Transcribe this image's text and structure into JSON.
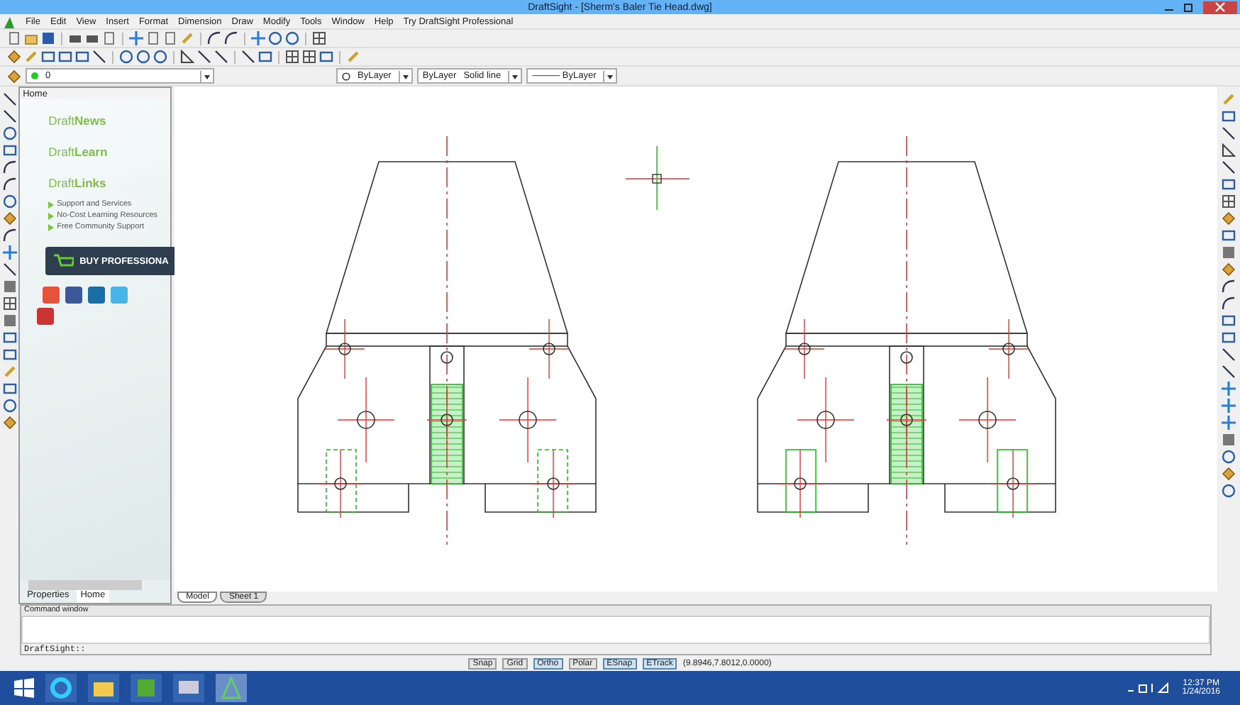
{
  "window": {
    "title": "DraftSight - [Sherm's Baler Tie Head.dwg]"
  },
  "menu": [
    "File",
    "Edit",
    "View",
    "Insert",
    "Format",
    "Dimension",
    "Draw",
    "Modify",
    "Tools",
    "Window",
    "Help",
    "Try DraftSight Professional"
  ],
  "layer_bar": {
    "layer": "0",
    "color_setting": "ByLayer",
    "linetype_layer": "ByLayer",
    "linetype": "Solid line",
    "lineweight": "——— ByLayer"
  },
  "palette": {
    "title": "Home",
    "sections": [
      "Draft**News**",
      "Draft**Learn**",
      "Draft**Links**"
    ],
    "links": [
      "Support and Services",
      "No-Cost Learning Resources",
      "Free Community Support"
    ],
    "buy_button": "BUY PROFESSIONA",
    "tabs": [
      {
        "label": "Properties",
        "selected": false
      },
      {
        "label": "Home",
        "selected": true
      }
    ]
  },
  "sheet_tabs": [
    {
      "label": "Model",
      "selected": true
    },
    {
      "label": "Sheet 1",
      "selected": false
    }
  ],
  "command_window": {
    "title": "Command window",
    "prompt": "DraftSight::"
  },
  "status_bar": {
    "toggles": [
      {
        "label": "Snap",
        "on": false
      },
      {
        "label": "Grid",
        "on": false
      },
      {
        "label": "Ortho",
        "on": true
      },
      {
        "label": "Polar",
        "on": false
      },
      {
        "label": "ESnap",
        "on": true
      },
      {
        "label": "ETrack",
        "on": true
      }
    ],
    "coordinates": "(9.8946,7.8012,0.0000)"
  },
  "taskbar": {
    "time": "12:37 PM",
    "date": "1/24/2016"
  }
}
